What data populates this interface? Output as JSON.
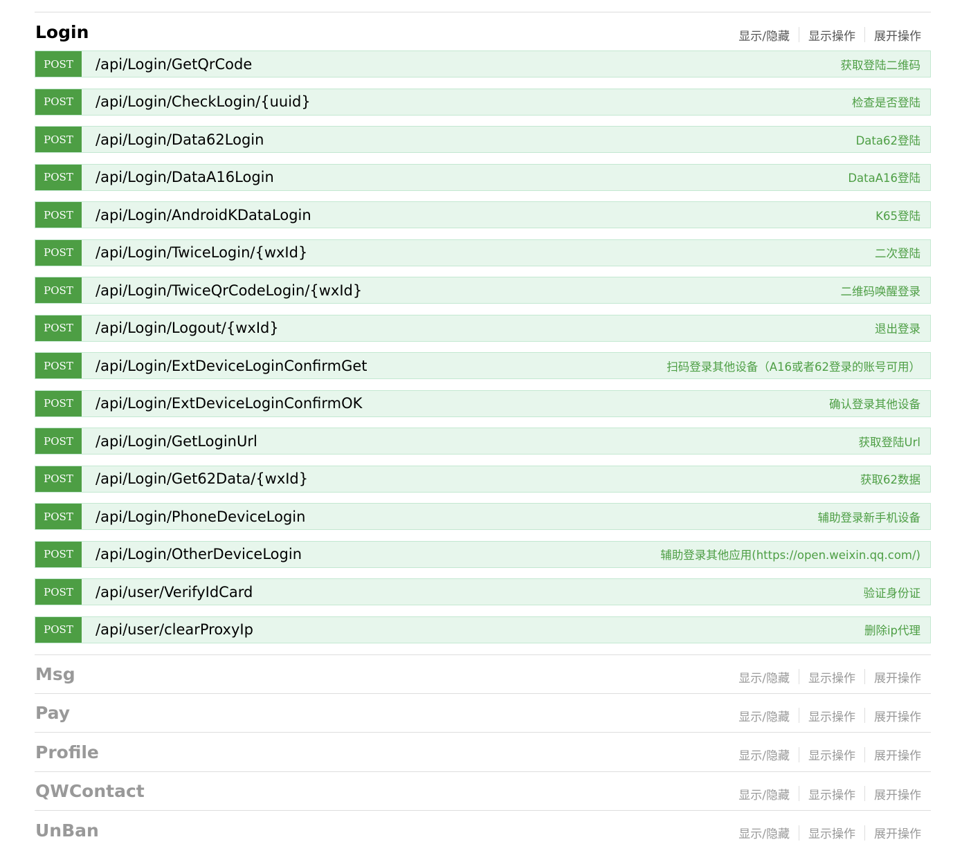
{
  "actions": {
    "toggle": "显示/隐藏",
    "list_ops": "显示操作",
    "expand_ops": "展开操作"
  },
  "login": {
    "title": "Login",
    "operations": [
      {
        "method": "POST",
        "path": "/api/Login/GetQrCode",
        "summary": "获取登陆二维码"
      },
      {
        "method": "POST",
        "path": "/api/Login/CheckLogin/{uuid}",
        "summary": "检查是否登陆"
      },
      {
        "method": "POST",
        "path": "/api/Login/Data62Login",
        "summary": "Data62登陆"
      },
      {
        "method": "POST",
        "path": "/api/Login/DataA16Login",
        "summary": "DataA16登陆"
      },
      {
        "method": "POST",
        "path": "/api/Login/AndroidKDataLogin",
        "summary": "K65登陆"
      },
      {
        "method": "POST",
        "path": "/api/Login/TwiceLogin/{wxId}",
        "summary": "二次登陆"
      },
      {
        "method": "POST",
        "path": "/api/Login/TwiceQrCodeLogin/{wxId}",
        "summary": "二维码唤醒登录"
      },
      {
        "method": "POST",
        "path": "/api/Login/Logout/{wxId}",
        "summary": "退出登录"
      },
      {
        "method": "POST",
        "path": "/api/Login/ExtDeviceLoginConfirmGet",
        "summary": "扫码登录其他设备（A16或者62登录的账号可用）"
      },
      {
        "method": "POST",
        "path": "/api/Login/ExtDeviceLoginConfirmOK",
        "summary": "确认登录其他设备"
      },
      {
        "method": "POST",
        "path": "/api/Login/GetLoginUrl",
        "summary": "获取登陆Url"
      },
      {
        "method": "POST",
        "path": "/api/Login/Get62Data/{wxId}",
        "summary": "获取62数据"
      },
      {
        "method": "POST",
        "path": "/api/Login/PhoneDeviceLogin",
        "summary": "辅助登录新手机设备"
      },
      {
        "method": "POST",
        "path": "/api/Login/OtherDeviceLogin",
        "summary": "辅助登录其他应用(https://open.weixin.qq.com/)"
      },
      {
        "method": "POST",
        "path": "/api/user/VerifyIdCard",
        "summary": "验证身份证"
      },
      {
        "method": "POST",
        "path": "/api/user/clearProxyIp",
        "summary": "删除ip代理"
      }
    ]
  },
  "collapsed_sections": [
    {
      "title": "Msg"
    },
    {
      "title": "Pay"
    },
    {
      "title": "Profile"
    },
    {
      "title": "QWContact"
    },
    {
      "title": "UnBan"
    }
  ],
  "colors": {
    "post_green": "#4d9e44",
    "op_bg": "#e7f6ec",
    "op_border": "#c3e8d1"
  }
}
